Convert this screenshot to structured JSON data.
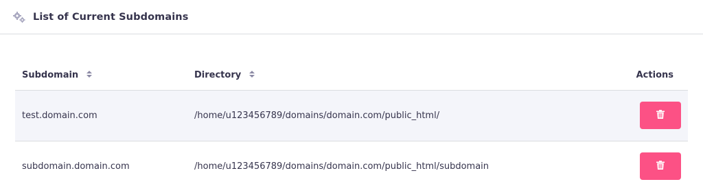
{
  "header": {
    "icon": "gears-icon",
    "title": "List of Current Subdomains"
  },
  "table": {
    "columns": {
      "subdomain": "Subdomain",
      "directory": "Directory",
      "actions": "Actions"
    },
    "rows": [
      {
        "subdomain": "test.domain.com",
        "directory": "/home/u123456789/domains/domain.com/public_html/"
      },
      {
        "subdomain": "subdomain.domain.com",
        "directory": "/home/u123456789/domains/domain.com/public_html/subdomain"
      }
    ]
  },
  "colors": {
    "delete_button": "#fc5185",
    "row_highlight": "#f4f5fa",
    "text": "#36344d"
  }
}
